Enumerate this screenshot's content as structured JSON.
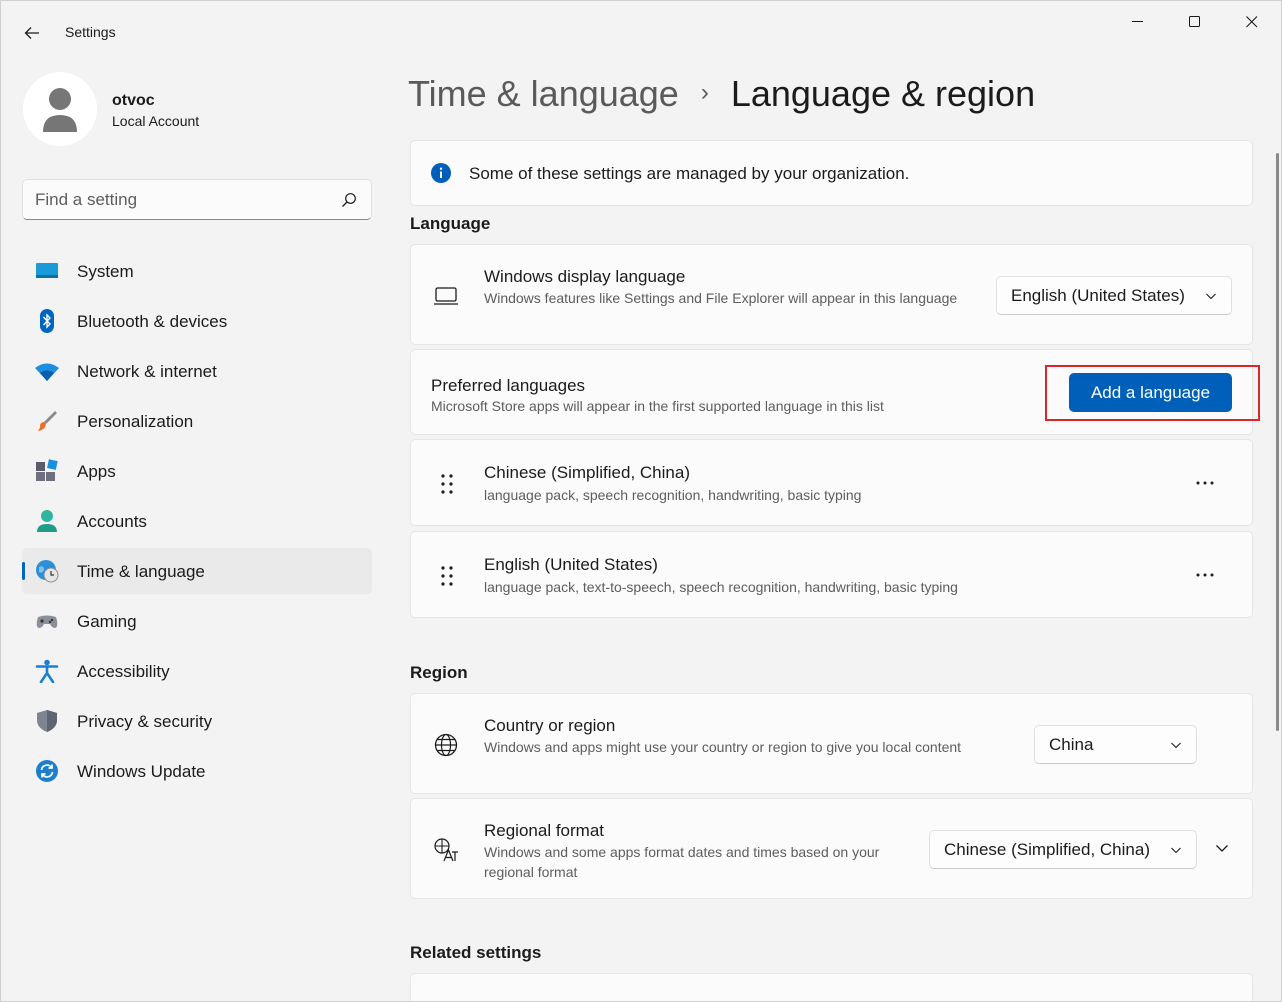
{
  "window": {
    "title": "Settings"
  },
  "profile": {
    "name": "otvoc",
    "account_type": "Local Account"
  },
  "search": {
    "placeholder": "Find a setting"
  },
  "sidebar": {
    "items": [
      {
        "label": "System",
        "icon": "monitor-icon"
      },
      {
        "label": "Bluetooth & devices",
        "icon": "bluetooth-icon"
      },
      {
        "label": "Network & internet",
        "icon": "wifi-icon"
      },
      {
        "label": "Personalization",
        "icon": "brush-icon"
      },
      {
        "label": "Apps",
        "icon": "apps-icon"
      },
      {
        "label": "Accounts",
        "icon": "person-icon"
      },
      {
        "label": "Time & language",
        "icon": "globe-clock-icon",
        "selected": true
      },
      {
        "label": "Gaming",
        "icon": "gamepad-icon"
      },
      {
        "label": "Accessibility",
        "icon": "accessibility-icon"
      },
      {
        "label": "Privacy & security",
        "icon": "shield-icon"
      },
      {
        "label": "Windows Update",
        "icon": "update-icon"
      }
    ]
  },
  "breadcrumb": {
    "parent": "Time & language",
    "separator": "›",
    "current": "Language & region"
  },
  "info_banner": {
    "text": "Some of these settings are managed by your organization."
  },
  "language": {
    "section_title": "Language",
    "display_language": {
      "title": "Windows display language",
      "description": "Windows features like Settings and File Explorer will appear in this language",
      "value": "English (United States)"
    },
    "preferred": {
      "title": "Preferred languages",
      "description": "Microsoft Store apps will appear in the first supported language in this list",
      "button": "Add a language"
    },
    "installed": [
      {
        "name": "Chinese (Simplified, China)",
        "features": "language pack, speech recognition, handwriting, basic typing"
      },
      {
        "name": "English (United States)",
        "features": "language pack, text-to-speech, speech recognition, handwriting, basic typing"
      }
    ]
  },
  "region": {
    "section_title": "Region",
    "country": {
      "title": "Country or region",
      "description": "Windows and apps might use your country or region to give you local content",
      "value": "China"
    },
    "format": {
      "title": "Regional format",
      "description": "Windows and some apps format dates and times based on your regional format",
      "value": "Chinese (Simplified, China)"
    }
  },
  "related": {
    "section_title": "Related settings"
  },
  "colors": {
    "accent": "#005fb8",
    "highlight": "#e0242c"
  }
}
